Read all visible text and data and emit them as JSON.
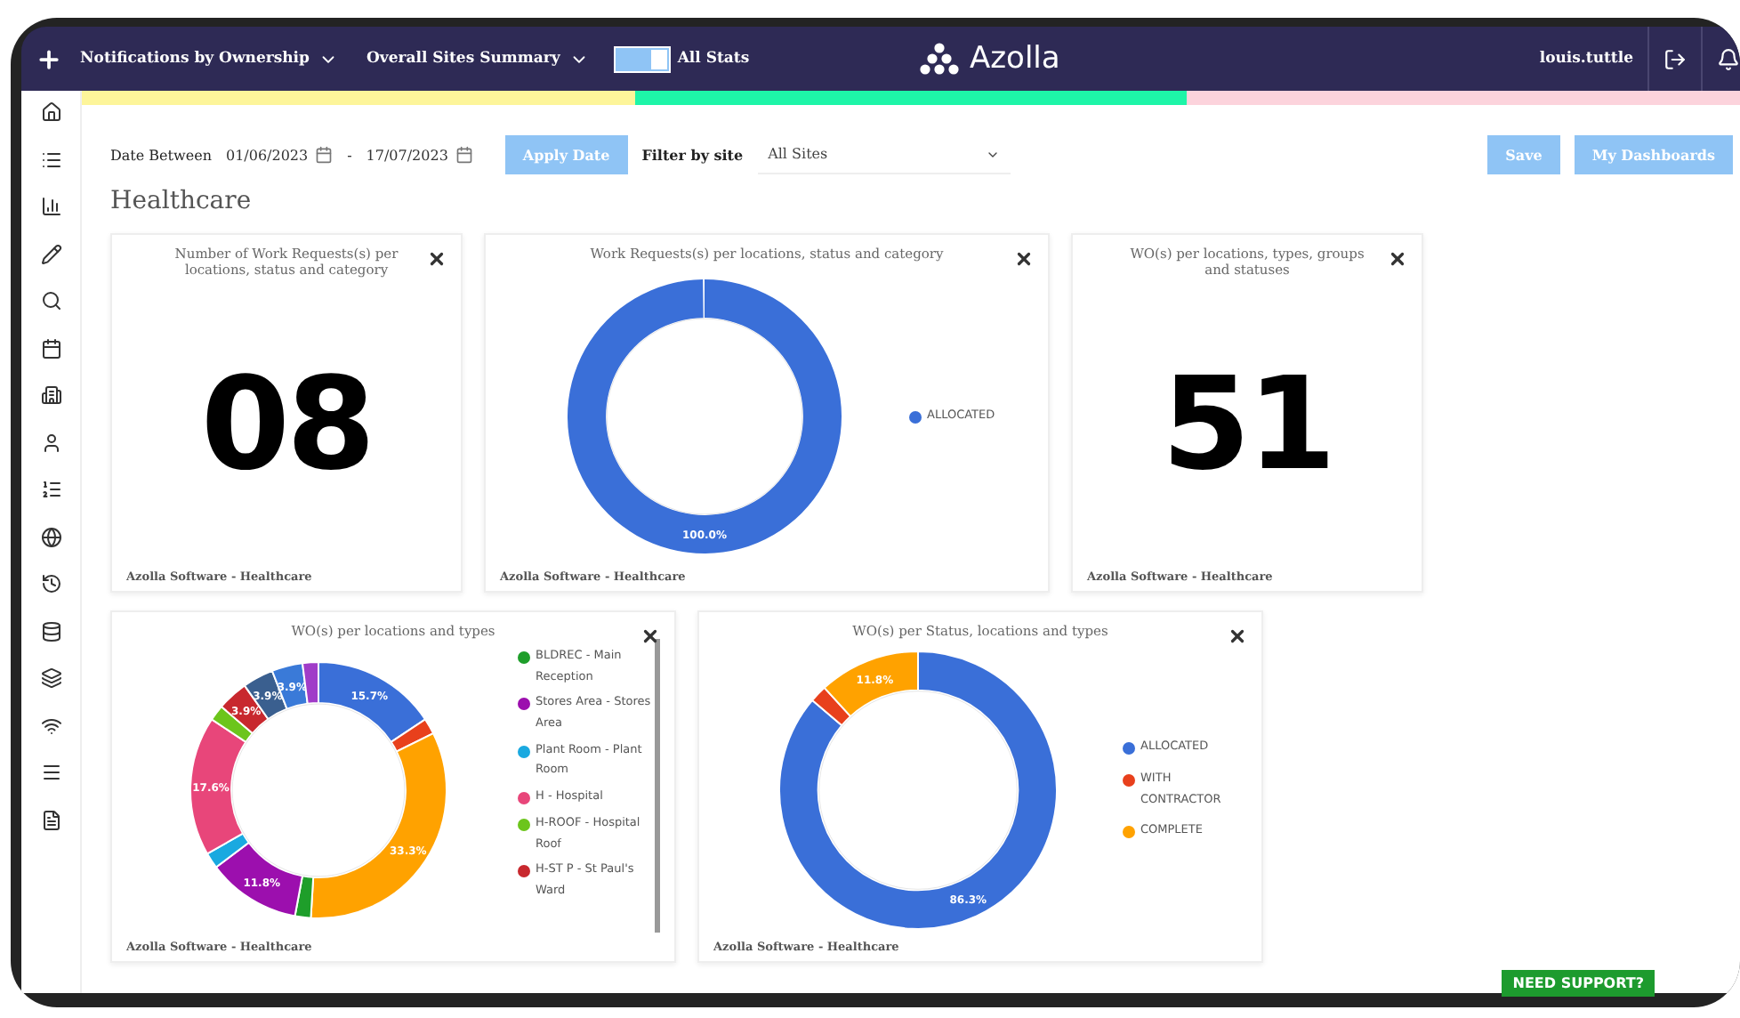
{
  "topbar": {
    "menus": [
      {
        "label": "Notifications by Ownership"
      },
      {
        "label": "Overall Sites Summary"
      }
    ],
    "toggle": {
      "label": "All Stats",
      "on": true
    },
    "logo": "Azolla",
    "user": "louis.tuttle"
  },
  "strip": [
    {
      "color": "#fdf59a"
    },
    {
      "color": "#1ef5a8"
    },
    {
      "color": "#fcd3dc"
    }
  ],
  "filters": {
    "date_label": "Date Between",
    "from": "01/06/2023",
    "separator": "-",
    "to": "17/07/2023",
    "apply": "Apply Date",
    "site_label": "Filter by site",
    "site": "All Sites"
  },
  "actions": [
    "Save",
    "My Dashboards"
  ],
  "heading": "Healthcare",
  "rows": [
    [
      {
        "kind": "number",
        "title": "Number of Work Requests(s) per locations, status and category",
        "value": "08",
        "footer": "Azolla Software - Healthcare"
      },
      {
        "kind": "donut",
        "title": "Work Requests(s) per locations, status and category",
        "footer": "Azolla Software - Healthcare",
        "chart_data": {
          "type": "donut",
          "categories": [
            "ALLOCATED"
          ],
          "values": [
            100.0
          ],
          "colors": [
            "#3a6fd8"
          ],
          "value_labels": [
            "100.0%"
          ]
        }
      },
      {
        "kind": "number",
        "title": "WO(s) per locations, types, groups and statuses",
        "value": "51",
        "footer": "Azolla Software - Healthcare"
      }
    ],
    [
      {
        "kind": "donut",
        "title": "WO(s) per locations and types",
        "footer": "Azolla Software - Healthcare",
        "scroll_legend": true,
        "legend": [
          {
            "label": "BLDREC - Main Reception",
            "color": "#1e9e2a"
          },
          {
            "label": "Stores Area - Stores Area",
            "color": "#9c0fae"
          },
          {
            "label": "Plant Room - Plant Room",
            "color": "#1aa9e0"
          },
          {
            "label": "H - Hospital",
            "color": "#e8467a"
          },
          {
            "label": "H-ROOF - Hospital Roof",
            "color": "#6cc51c"
          },
          {
            "label": "H-ST P - St Paul's Ward",
            "color": "#c8282e"
          }
        ],
        "chart_data": {
          "type": "donut",
          "values": [
            15.7,
            2.0,
            33.3,
            2.0,
            11.8,
            2.0,
            17.6,
            2.0,
            3.9,
            3.9,
            3.9,
            2.0
          ],
          "colors": [
            "#3a6fd8",
            "#e8401c",
            "#ffa200",
            "#1e9e2a",
            "#9c0fae",
            "#1aa9e0",
            "#e8467a",
            "#6cc51c",
            "#c8282e",
            "#3a5f8f",
            "#3a7ad8",
            "#a03cc8"
          ],
          "value_labels": [
            "15.7%",
            null,
            "33.3%",
            null,
            "11.8%",
            null,
            "17.6%",
            null,
            "3.9%",
            "3.9%",
            "3.9%",
            null
          ]
        }
      },
      {
        "kind": "donut",
        "title": "WO(s) per Status, locations and types",
        "footer": "Azolla Software - Healthcare",
        "chart_data": {
          "type": "donut",
          "categories": [
            "ALLOCATED",
            "WITH CONTRACTOR",
            "COMPLETE"
          ],
          "values": [
            86.3,
            2.0,
            11.8
          ],
          "colors": [
            "#3a6fd8",
            "#e8401c",
            "#ffa200"
          ],
          "value_labels": [
            "86.3%",
            null,
            "11.8%"
          ]
        }
      }
    ]
  ],
  "support": "NEED SUPPORT?"
}
